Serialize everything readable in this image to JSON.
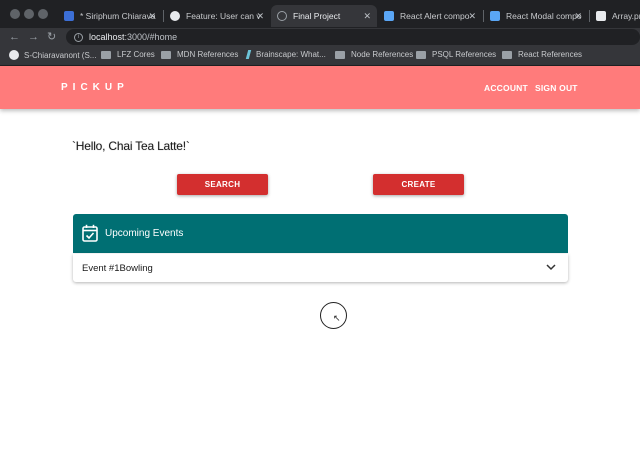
{
  "browser": {
    "tabs": [
      {
        "title": "* Siriphum Chiarava",
        "icon": "app-icon",
        "color": "#3c6fd6"
      },
      {
        "title": "Feature: User can v",
        "icon": "github-icon",
        "color": "#e8eaed"
      },
      {
        "title": "Final Project",
        "icon": "globe-icon",
        "color": "#9aa0a6"
      },
      {
        "title": "React Alert compo",
        "icon": "codesandbox-icon",
        "color": "#5aa6f5"
      },
      {
        "title": "React Modal compo",
        "icon": "codesandbox-icon",
        "color": "#5aa6f5"
      },
      {
        "title": "Array.pro",
        "icon": "mdn-icon",
        "color": "#e8eaed"
      }
    ],
    "address": {
      "host": "localhost",
      "rest": ":3000/#home"
    },
    "bookmarks": [
      {
        "label": "S-Chiaravanont (S...",
        "icon": "github-icon"
      },
      {
        "label": "LFZ Cores",
        "icon": "folder-icon"
      },
      {
        "label": "MDN References",
        "icon": "folder-icon"
      },
      {
        "label": "Brainscape: What...",
        "icon": "brainscape-icon"
      },
      {
        "label": "Node References",
        "icon": "folder-icon"
      },
      {
        "label": "PSQL References",
        "icon": "folder-icon"
      },
      {
        "label": "React References",
        "icon": "folder-icon"
      }
    ]
  },
  "header": {
    "brand": "PICKUP",
    "nav": {
      "account": "ACCOUNT",
      "signout": "SIGN OUT"
    },
    "color": "#ff7b7b"
  },
  "main": {
    "greeting": "`Hello, Chai Tea Latte!`",
    "search_label": "SEARCH",
    "create_label": "CREATE",
    "events": {
      "title": "Upcoming Events",
      "items": [
        {
          "label": "Event #1Bowling"
        }
      ]
    },
    "accent": "#d32f2f",
    "teal": "#006f73"
  }
}
